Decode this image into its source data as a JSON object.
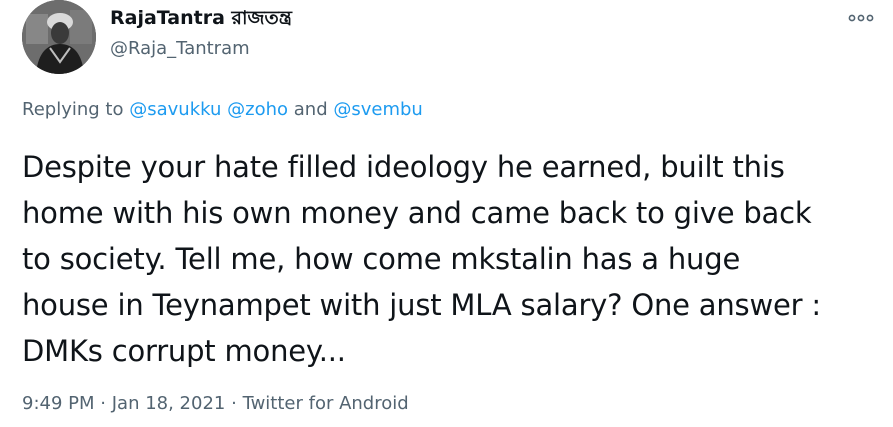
{
  "author": {
    "name": "RajaTantra রাজতন্ত্র",
    "handle": "@Raja_Tantram",
    "avatar_icon": "profile-avatar"
  },
  "more_icon": "more-horizontal-icon",
  "reply": {
    "prefix": "Replying to",
    "mentions": [
      "@savukku",
      "@zoho",
      "@svembu"
    ],
    "separator_and": "and"
  },
  "tweet": {
    "lines": [
      "Despite your hate filled ideology he earned, built this",
      "home with his own money and came back to give back",
      "to society. Tell me, how come mkstalin has a huge",
      "house in Teynampet with just MLA salary? One answer :",
      "DMKs corrupt money..."
    ]
  },
  "meta": {
    "time": "9:49 PM",
    "date": "Jan 18, 2021",
    "source": "Twitter for Android",
    "separator": "·"
  },
  "colors": {
    "text": "#0f1419",
    "secondary": "#536471",
    "link": "#1d9bf0"
  }
}
